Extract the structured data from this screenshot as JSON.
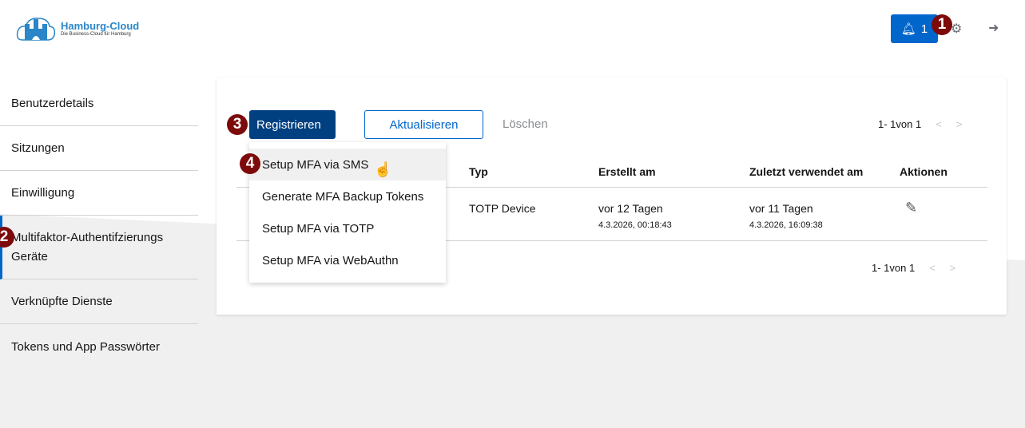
{
  "header": {
    "logo_title": "Hamburg-Cloud",
    "logo_subtitle": "Die Business-Cloud für Hamburg",
    "notification_count": "1"
  },
  "annotations": [
    "1",
    "2",
    "3",
    "4"
  ],
  "sidebar": {
    "items": [
      {
        "label": "Benutzerdetails"
      },
      {
        "label": "Sitzungen"
      },
      {
        "label": "Einwilligung"
      },
      {
        "label": "Multifaktor-Authentifzierungs Geräte"
      },
      {
        "label": "Verknüpfte Dienste"
      },
      {
        "label": "Tokens und App Passwörter"
      }
    ]
  },
  "toolbar": {
    "register_label": "Registrieren",
    "refresh_label": "Aktualisieren",
    "delete_label": "Löschen",
    "pagination": "1- 1von 1"
  },
  "dropdown": {
    "items": [
      "Setup MFA via SMS",
      "Generate MFA Backup Tokens",
      "Setup MFA via TOTP",
      "Setup MFA via WebAuthn"
    ]
  },
  "table": {
    "headers": [
      "Typ",
      "Erstellt am",
      "Zuletzt verwendet am",
      "Aktionen"
    ],
    "rows": [
      {
        "type": "TOTP Device",
        "created": "vor 12 Tagen",
        "created_date": "4.3.2026, 00:18:43",
        "last_used": "vor 11 Tagen",
        "last_used_date": "4.3.2026, 16:09:38"
      }
    ]
  },
  "colors": {
    "primary": "#0066cc",
    "dark_primary": "#004080",
    "annotation": "#7d0a0a"
  }
}
